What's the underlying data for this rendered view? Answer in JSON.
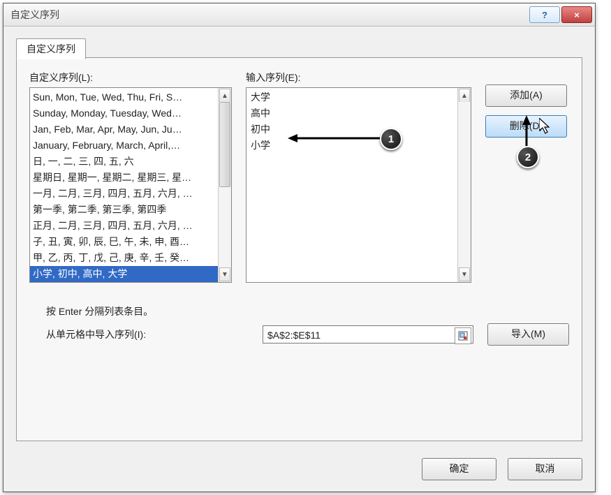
{
  "window": {
    "title": "自定义序列",
    "help_symbol": "?",
    "close_symbol": "×"
  },
  "tab": {
    "label": "自定义序列"
  },
  "left": {
    "label": "自定义序列(L):",
    "lines": [
      "Sun, Mon, Tue, Wed, Thu, Fri, S…",
      "Sunday, Monday, Tuesday, Wed…",
      "Jan, Feb, Mar, Apr, May, Jun, Ju…",
      "January, February, March, April,…",
      "日, 一, 二, 三, 四, 五, 六",
      "星期日, 星期一, 星期二, 星期三, 星…",
      "一月, 二月, 三月, 四月, 五月, 六月, …",
      "第一季, 第二季, 第三季, 第四季",
      "正月, 二月, 三月, 四月, 五月, 六月, …",
      "子, 丑, 寅, 卯, 辰, 巳, 午, 未, 申, 酉…",
      "甲, 乙, 丙, 丁, 戊, 己, 庚, 辛, 壬, 癸…"
    ],
    "selected_line": "小学, 初中, 高中, 大学"
  },
  "entry": {
    "label": "输入序列(E):",
    "lines": [
      "大学",
      "高中",
      "初中",
      "小学"
    ]
  },
  "buttons": {
    "add": "添加(A)",
    "delete": "删除(D)",
    "import": "导入(M)",
    "ok": "确定",
    "cancel": "取消"
  },
  "notes": {
    "enter_hint": "按 Enter 分隔列表条目。",
    "import_label": "从单元格中导入序列(I):"
  },
  "range_input": {
    "value": "$A$2:$E$11"
  },
  "annotations": {
    "bubble1": "1",
    "bubble2": "2"
  }
}
